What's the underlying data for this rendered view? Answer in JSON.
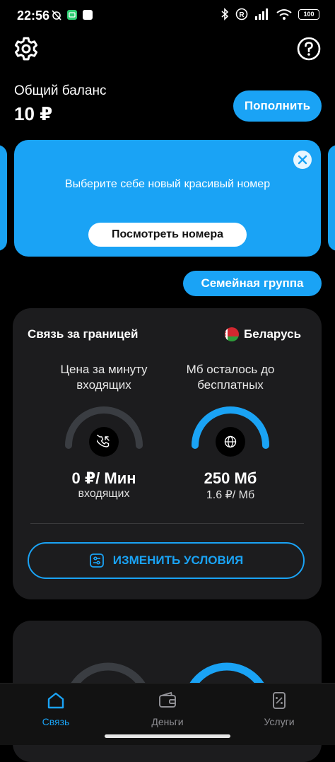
{
  "status_bar": {
    "time": "22:56",
    "battery": "100"
  },
  "header": {
    "balance_label": "Общий баланс",
    "balance_value": "10 ₽",
    "topup_label": "Пополнить"
  },
  "promo": {
    "text": "Выберите себе новый красивый номер",
    "button_label": "Посмотреть номера"
  },
  "family_button": "Семейная группа",
  "roaming": {
    "title": "Связь за границей",
    "country": "Беларусь",
    "left_gauge": {
      "caption": "Цена за минуту входящих",
      "value": "0 ₽/ Мин",
      "subvalue": "входящих",
      "fill": 0.0
    },
    "right_gauge": {
      "caption": "Мб осталось до бесплатных",
      "value": "250 Мб",
      "subvalue": "1.6 ₽/ Мб",
      "fill": 1.0
    },
    "change_button": "ИЗМЕНИТЬ УСЛОВИЯ"
  },
  "nav": [
    {
      "label": "Связь",
      "icon": "home-icon",
      "active": true
    },
    {
      "label": "Деньги",
      "icon": "wallet-icon",
      "active": false
    },
    {
      "label": "Услуги",
      "icon": "services-icon",
      "active": false
    }
  ],
  "colors": {
    "accent": "#1aa3f5",
    "card": "#1c1c1e",
    "background": "#000000",
    "gauge_track": "#3a3d42",
    "inactive": "#8e8e93"
  }
}
